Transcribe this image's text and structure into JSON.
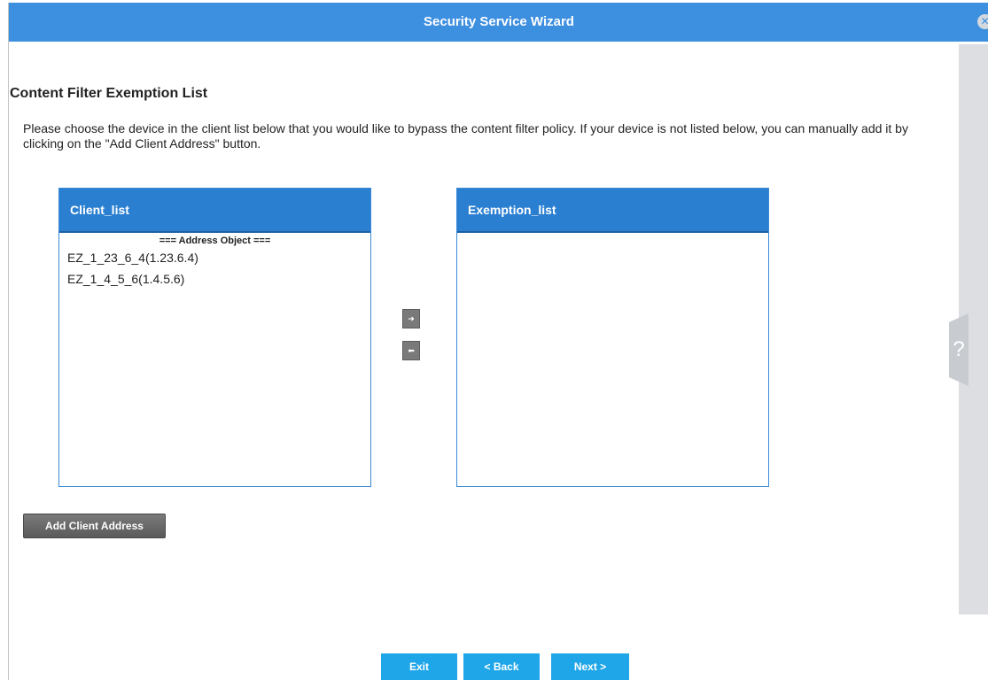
{
  "window": {
    "title": "Security Service Wizard",
    "close_icon": "close-icon"
  },
  "page": {
    "title": "Content Filter Exemption List",
    "description": "Please choose the device in the client list below that you would like to bypass the content filter policy. If your device is not listed below, you can manually add it by clicking on the \"Add Client Address\" button."
  },
  "client_list": {
    "header": "Client_list",
    "group_label": "=== Address Object ===",
    "items": [
      "EZ_1_23_6_4(1.23.6.4)",
      "EZ_1_4_5_6(1.4.5.6)"
    ]
  },
  "exemption_list": {
    "header": "Exemption_list",
    "items": []
  },
  "transfer": {
    "add_icon": "arrow-right-icon",
    "remove_icon": "arrow-left-icon"
  },
  "buttons": {
    "add_client": "Add Client Address",
    "exit": "Exit",
    "back": "< Back",
    "next": "Next >"
  },
  "help": {
    "label": "?"
  },
  "colors": {
    "titlebar": "#3d8fe0",
    "list_header": "#2b7fd1",
    "nav_button": "#1fa6e8",
    "add_button": "#6a6a6a"
  }
}
